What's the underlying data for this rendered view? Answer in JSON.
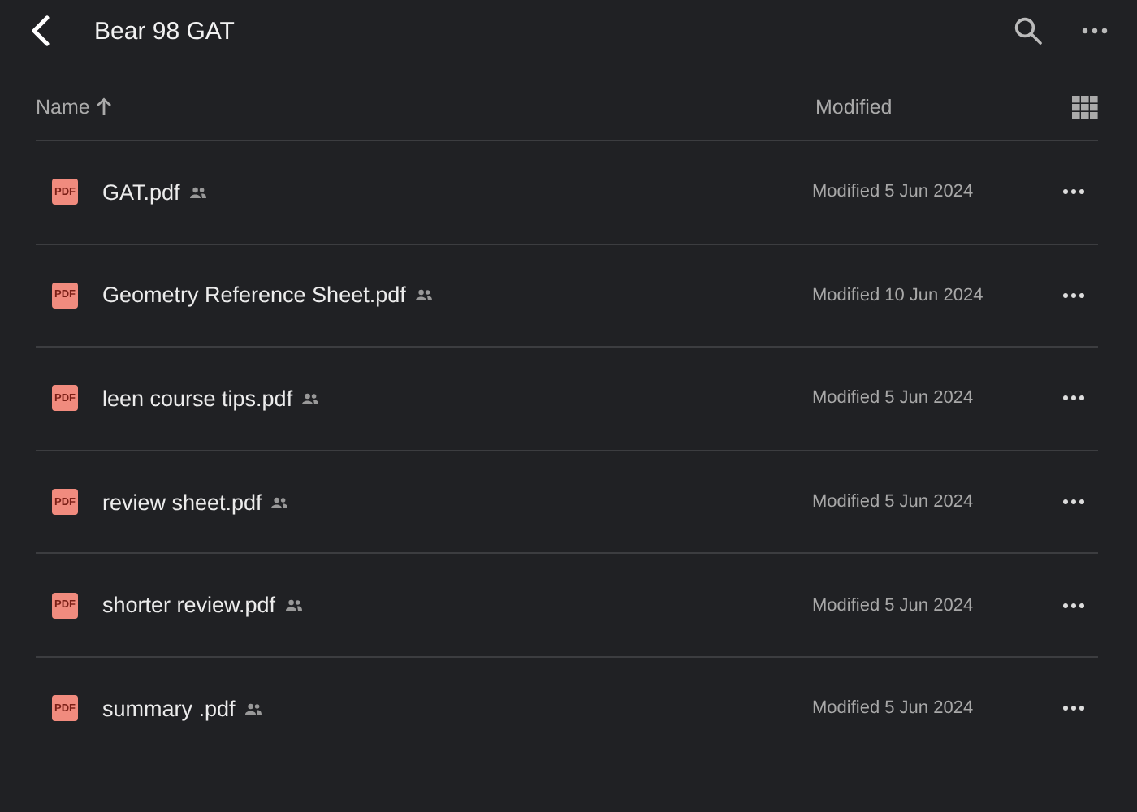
{
  "header": {
    "title": "Bear 98 GAT"
  },
  "columns": {
    "name": "Name",
    "modified": "Modified"
  },
  "files": [
    {
      "badge": "PDF",
      "name": "GAT.pdf",
      "shared": true,
      "modified": "Modified 5 Jun 2024"
    },
    {
      "badge": "PDF",
      "name": "Geometry Reference Sheet.pdf",
      "shared": true,
      "modified": "Modified 10 Jun 2024"
    },
    {
      "badge": "PDF",
      "name": "leen course tips.pdf",
      "shared": true,
      "modified": "Modified 5 Jun 2024"
    },
    {
      "badge": "PDF",
      "name": "review sheet.pdf",
      "shared": true,
      "modified": "Modified 5 Jun 2024"
    },
    {
      "badge": "PDF",
      "name": "shorter review.pdf",
      "shared": true,
      "modified": "Modified 5 Jun 2024"
    },
    {
      "badge": "PDF",
      "name": "summary .pdf",
      "shared": true,
      "modified": "Modified 5 Jun 2024"
    }
  ]
}
